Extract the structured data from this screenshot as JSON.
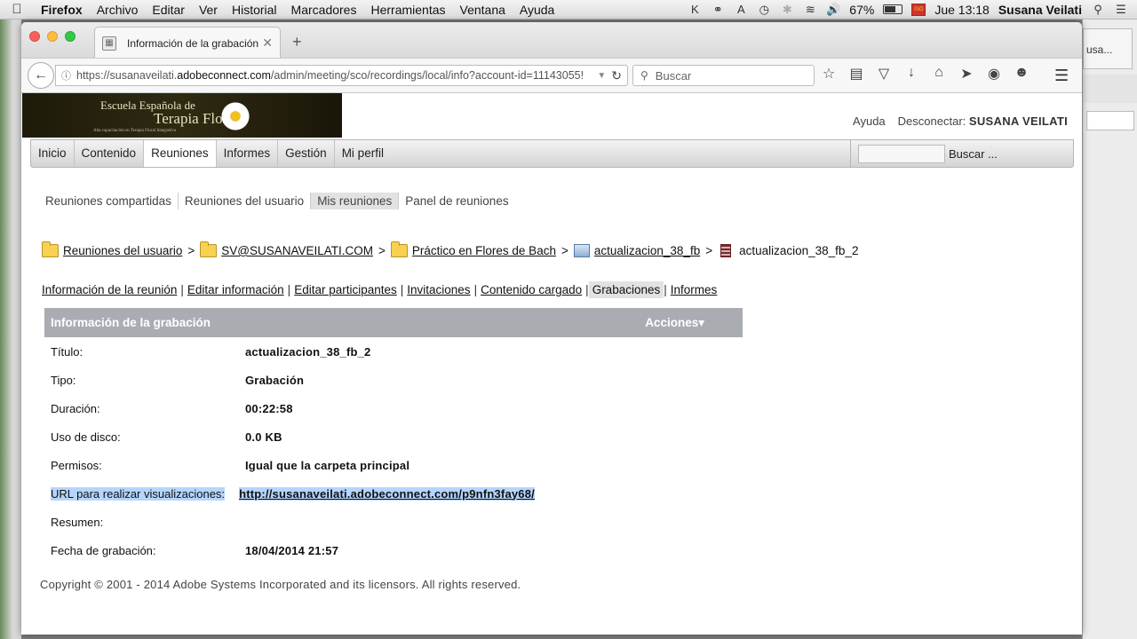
{
  "menubar": {
    "apple": "",
    "app_name": "Firefox",
    "items": [
      "Archivo",
      "Editar",
      "Ver",
      "Historial",
      "Marcadores",
      "Herramientas",
      "Ventana",
      "Ayuda"
    ],
    "battery": "67%",
    "battery_level": 0.67,
    "clock": "Jue 13:18",
    "user": "Susana Veilati"
  },
  "background_window": {
    "tab_fragment": "usa..."
  },
  "browser": {
    "tab_title": "Información de la grabación",
    "url_prefix": "https://susanaveilati.",
    "url_host": "adobeconnect.com",
    "url_path": "/admin/meeting/sco/recordings/local/info?account-id=11143055!",
    "search_placeholder": "Buscar"
  },
  "logo": {
    "line1": "Escuela Española de",
    "line2": "Terapia Floral",
    "line3": "Alta capacitación en Terapia Floral Integrativa"
  },
  "header": {
    "help": "Ayuda",
    "logout_label": "Desconectar:",
    "username": "SUSANA VEILATI"
  },
  "mainnav": {
    "items": [
      "Inicio",
      "Contenido",
      "Reuniones",
      "Informes",
      "Gestión",
      "Mi perfil"
    ],
    "active": "Reuniones",
    "search_button": "Buscar ..."
  },
  "subnav": {
    "items": [
      "Reuniones compartidas",
      "Reuniones del usuario",
      "Mis reuniones",
      "Panel de reuniones"
    ],
    "active": "Mis reuniones"
  },
  "breadcrumb": {
    "items": [
      "Reuniones del usuario",
      "SV@SUSANAVEILATI.COM",
      "Práctico en Flores de Bach",
      "actualizacion_38_fb",
      "actualizacion_38_fb_2"
    ],
    "separator": ">"
  },
  "tabs": {
    "items": [
      "Información de la reunión",
      "Editar información",
      "Editar participantes",
      "Invitaciones",
      "Contenido cargado",
      "Grabaciones",
      "Informes"
    ],
    "active": "Grabaciones"
  },
  "panel": {
    "title": "Información de la grabación",
    "actions": "Acciones",
    "rows": [
      {
        "label": "Título:",
        "value": "actualizacion_38_fb_2"
      },
      {
        "label": "Tipo:",
        "value": "Grabación"
      },
      {
        "label": "Duración:",
        "value": "00:22:58"
      },
      {
        "label": "Uso de disco:",
        "value": "0.0 KB"
      },
      {
        "label": "Permisos:",
        "value": "Igual que la carpeta principal"
      },
      {
        "label": "URL para realizar visualizaciones:",
        "value": "http://susanaveilati.adobeconnect.com/p9nfn3fay68/"
      },
      {
        "label": "Resumen:",
        "value": ""
      },
      {
        "label": "Fecha de grabación:",
        "value": "18/04/2014 21:57"
      }
    ]
  },
  "footer": {
    "copyright": "Copyright © 2001 - 2014 Adobe Systems Incorporated and its licensors. All rights reserved."
  },
  "colors": {
    "panel_header": "#a9adb2",
    "selection": "#b4d5fe",
    "logo_bg": "#2f2a12"
  }
}
